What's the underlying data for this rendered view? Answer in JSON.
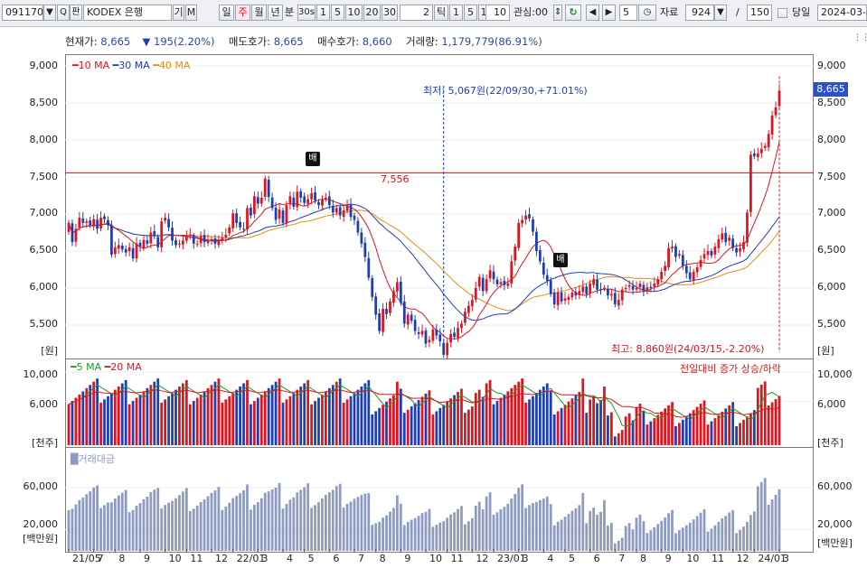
{
  "toolbar": {
    "code": "091170",
    "dropdown_icon": "chevron-down-icon",
    "search_label": "Q",
    "search_icon": "magnifier-icon",
    "search_kanji": "판",
    "name": "KODEX 은행",
    "gi": "기",
    "m": "M",
    "periods": [
      "일",
      "주",
      "월",
      "년",
      "분",
      "30s",
      "1",
      "5",
      "10",
      "20",
      "30"
    ],
    "selected_period": "주",
    "tick_value": "2",
    "tick_label": "틱",
    "tick_opts": [
      "1",
      "5",
      "10"
    ],
    "tick_field": "10",
    "interest_label": "관심:00",
    "refresh_icon": "refresh-icon",
    "prev_icon": "prev-icon",
    "next_icon": "next-icon",
    "step_value": "5",
    "clock_icon": "clock-icon",
    "data_label": "자료",
    "data_count": "924",
    "slash": "/",
    "view_count": "150",
    "today_label": "당일",
    "date": "2024-03-"
  },
  "info": {
    "current_label": "현재가:",
    "current_value": "8,665",
    "change_value": "195(2.20%)",
    "ask_label": "매도호가:",
    "ask_value": "8,665",
    "bid_label": "매수호가:",
    "bid_value": "8,660",
    "volume_label": "거래량:",
    "volume_value": "1,179,779(86.91%)"
  },
  "price_panel": {
    "legend": [
      {
        "name": "10 MA",
        "color": "#e0141e"
      },
      {
        "name": "30 MA",
        "color": "#1f3fb0"
      },
      {
        "name": "40 MA",
        "color": "#ee8a10"
      }
    ],
    "y_ticks": [
      "9,000",
      "8,500",
      "8,000",
      "7,500",
      "7,000",
      "6,500",
      "6,000",
      "5,500"
    ],
    "unit": "[원]",
    "current_price_tag": "8,665",
    "hline_value": "7,556",
    "low_annotation": "최저: 5,067원(22/09/30,+71.01%)",
    "high_annotation": "최고: 8,860원(24/03/15,-2.20%)",
    "dividend_marker": "배"
  },
  "volume_panel": {
    "legend": [
      {
        "name": "5 MA",
        "color": "#1f9a2a"
      },
      {
        "name": "20 MA",
        "color": "#e0141e"
      }
    ],
    "note": "전일대비 증가 상승/하락",
    "y_ticks": [
      "10,000",
      "6,000"
    ],
    "unit": "[천주]"
  },
  "amount_panel": {
    "legend": "거래대금",
    "y_ticks": [
      "60,000",
      "20,000"
    ],
    "unit": "[백만원]"
  },
  "x_axis": [
    "21/05",
    "7",
    "8",
    "9",
    "10",
    "11",
    "12",
    "22/01",
    "3",
    "4",
    "5",
    "6",
    "7",
    "8",
    "9",
    "10",
    "11",
    "12",
    "23/01",
    "3",
    "4",
    "5",
    "6",
    "7",
    "8",
    "9",
    "10",
    "11",
    "12",
    "24/01",
    "3"
  ],
  "colors": {
    "up": "#e0141e",
    "down": "#1f3fb0",
    "ma40": "#ee8a10",
    "ma5": "#1f9a2a",
    "amount": "#8e9bc0"
  },
  "chart_data": {
    "type": "candlestick",
    "ylim": [
      5000,
      9000
    ],
    "closes": [
      6880,
      6620,
      6800,
      6950,
      6880,
      6900,
      6850,
      6930,
      6800,
      6950,
      6930,
      6850,
      6450,
      6550,
      6580,
      6520,
      6480,
      6550,
      6400,
      6600,
      6560,
      6650,
      6600,
      6750,
      6700,
      6550,
      6900,
      6950,
      6820,
      6640,
      6580,
      6600,
      6640,
      6700,
      6720,
      6600,
      6600,
      6700,
      6620,
      6640,
      6660,
      6600,
      6650,
      6680,
      6720,
      6820,
      7010,
      6880,
      6820,
      6800,
      7080,
      6980,
      7240,
      7140,
      7220,
      7480,
      7230,
      7080,
      6920,
      7060,
      6880,
      7120,
      7240,
      7100,
      7300,
      7220,
      7150,
      7200,
      7280,
      7180,
      7120,
      7200,
      7220,
      7120,
      7020,
      7080,
      6980,
      7050,
      7120,
      6960,
      6920,
      6750,
      6600,
      6420,
      6140,
      5880,
      5640,
      5420,
      5720,
      5650,
      5820,
      5960,
      6080,
      5800,
      5520,
      5640,
      5560,
      5420,
      5380,
      5420,
      5250,
      5300,
      5440,
      5360,
      5280,
      5100,
      5260,
      5380,
      5340,
      5460,
      5520,
      5680,
      5760,
      5840,
      6000,
      6150,
      5960,
      6120,
      6240,
      6120,
      6050,
      6080,
      6040,
      6060,
      6360,
      6560,
      6880,
      6920,
      6980,
      6940,
      6760,
      6500,
      6360,
      6180,
      6100,
      5920,
      5780,
      5940,
      5820,
      5860,
      5880,
      5940,
      5900,
      5960,
      6020,
      5920,
      6060,
      6120,
      5980,
      5980,
      6000,
      5900,
      5920,
      5780,
      5840,
      5980,
      6000,
      6040,
      5980,
      6000,
      6060,
      5960,
      6010,
      6000,
      6060,
      6120,
      6220,
      6300,
      6540,
      6560,
      6420,
      6460,
      6300,
      6200,
      6120,
      6220,
      6280,
      6380,
      6460,
      6500,
      6440,
      6560,
      6660,
      6740,
      6620,
      6680,
      6540,
      6480,
      6540,
      6620,
      7020,
      7800,
      7780,
      7820,
      7880,
      7920,
      8080,
      8330,
      8440,
      8665
    ],
    "extremes": {
      "low": 5067,
      "high": 8860
    },
    "hline": 7556,
    "volume_ylim": [
      0,
      12000
    ],
    "amount_ylim": [
      0,
      90000
    ]
  }
}
